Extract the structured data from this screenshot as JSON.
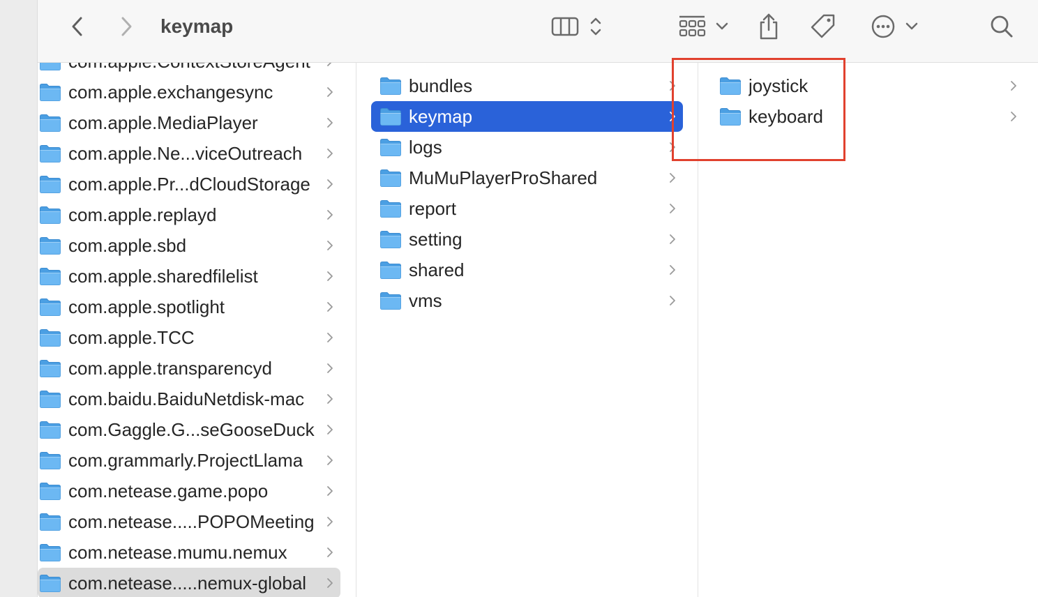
{
  "window": {
    "title": "keymap"
  },
  "toolbar": {
    "icons": [
      "back-chevron-icon",
      "forward-chevron-icon",
      "column-view-icon",
      "sort-updown-icon",
      "grid-group-icon",
      "chevron-down-icon",
      "share-icon",
      "tag-icon",
      "more-options-icon",
      "search-icon"
    ]
  },
  "column1": {
    "items": [
      {
        "label": "com.apple.ContextStoreAgent"
      },
      {
        "label": "com.apple.exchangesync"
      },
      {
        "label": "com.apple.MediaPlayer"
      },
      {
        "label": "com.apple.Ne...viceOutreach"
      },
      {
        "label": "com.apple.Pr...dCloudStorage"
      },
      {
        "label": "com.apple.replayd"
      },
      {
        "label": "com.apple.sbd"
      },
      {
        "label": "com.apple.sharedfilelist"
      },
      {
        "label": "com.apple.spotlight"
      },
      {
        "label": "com.apple.TCC"
      },
      {
        "label": "com.apple.transparencyd"
      },
      {
        "label": "com.baidu.BaiduNetdisk-mac"
      },
      {
        "label": "com.Gaggle.G...seGooseDuck"
      },
      {
        "label": "com.grammarly.ProjectLlama"
      },
      {
        "label": "com.netease.game.popo"
      },
      {
        "label": "com.netease.....POPOMeeting"
      },
      {
        "label": "com.netease.mumu.nemux"
      },
      {
        "label": "com.netease.....nemux-global"
      }
    ]
  },
  "column2": {
    "items": [
      {
        "label": "bundles"
      },
      {
        "label": "keymap"
      },
      {
        "label": "logs"
      },
      {
        "label": "MuMuPlayerProShared"
      },
      {
        "label": "report"
      },
      {
        "label": "setting"
      },
      {
        "label": "shared"
      },
      {
        "label": "vms"
      }
    ]
  },
  "column3": {
    "items": [
      {
        "label": "joystick"
      },
      {
        "label": "keyboard"
      }
    ]
  },
  "colors": {
    "selection": "#2a62d9",
    "folder": "#5aaef0",
    "highlight_box": "#e1412e"
  }
}
